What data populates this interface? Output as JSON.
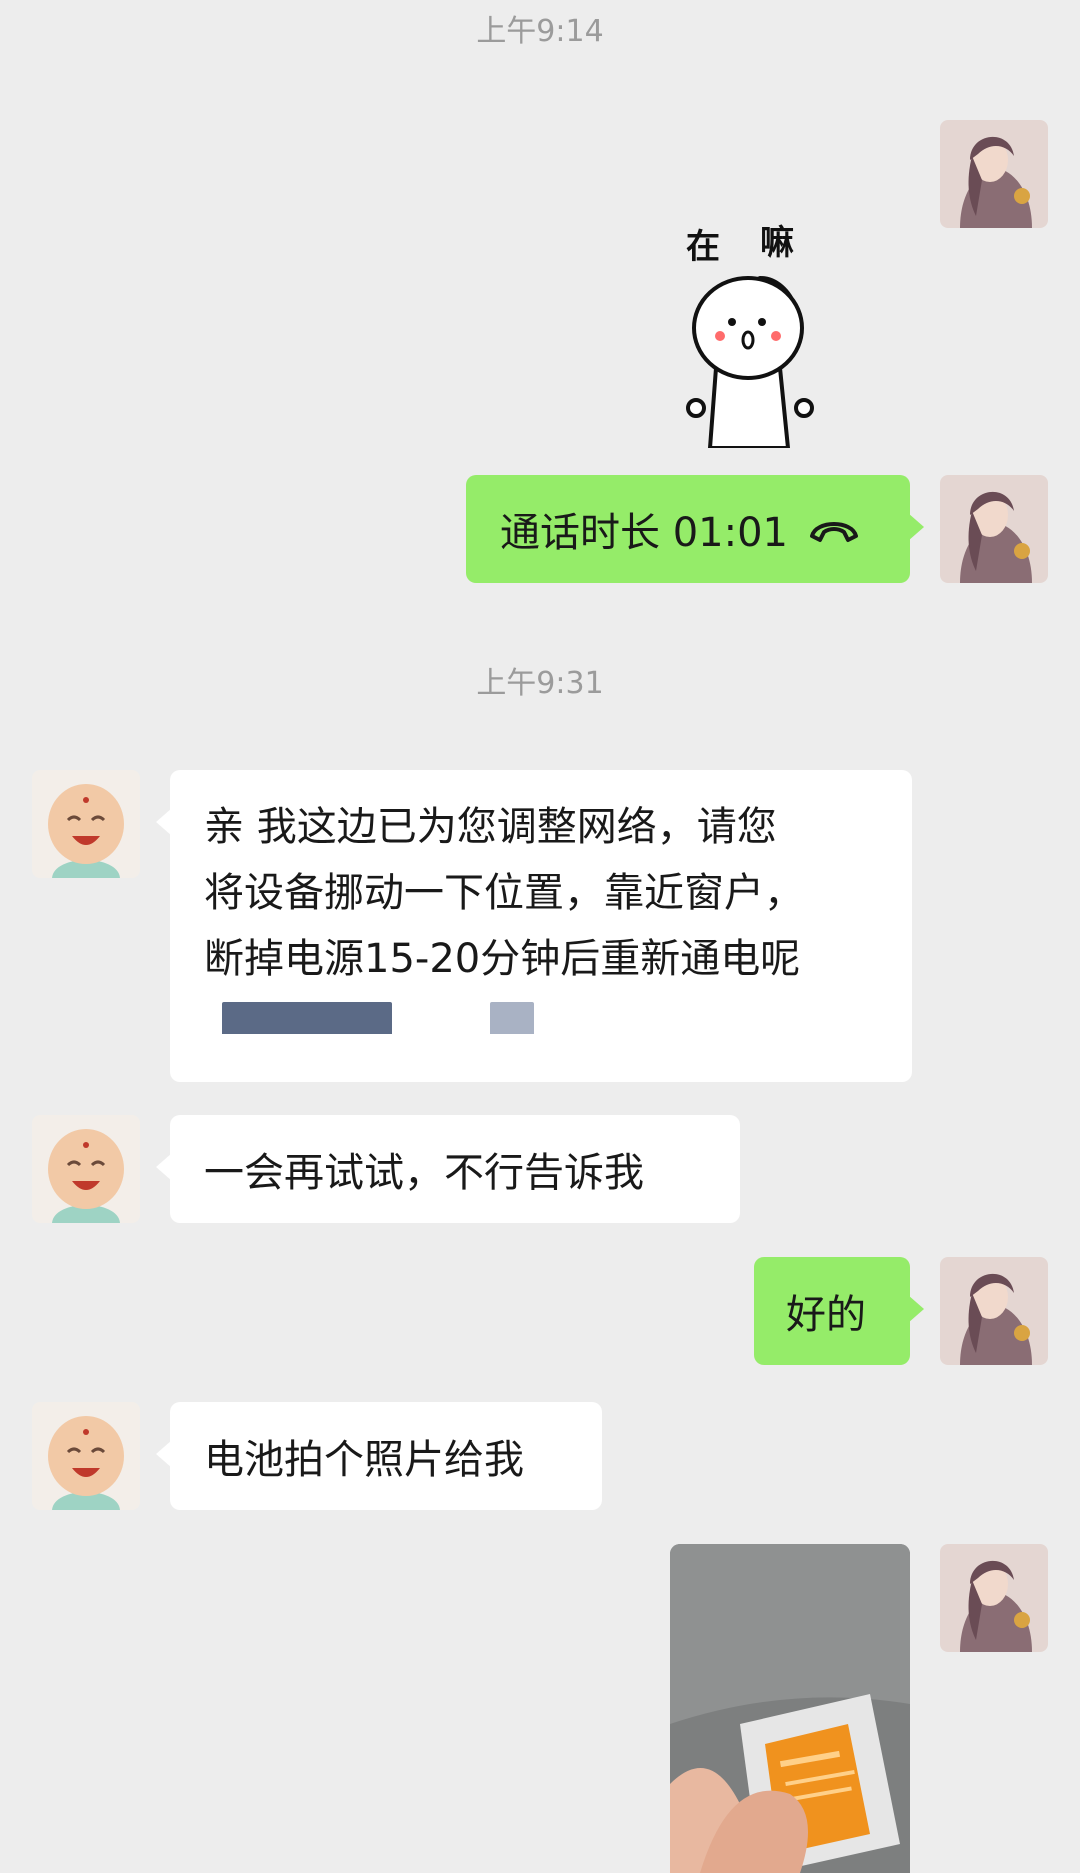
{
  "chat": {
    "timestamps": [
      "上午9:14",
      "上午9:31"
    ],
    "sticker": {
      "text_left": "在",
      "text_right": "嘛"
    },
    "call_message": {
      "label": "通话时长 01:01",
      "icon": "phone-hangup-icon"
    },
    "agent_message_1": {
      "lines": [
        "亲 我这边已为您调整网络，请您",
        "将设备挪动一下位置，靠近窗户，",
        "断掉电源15-20分钟后重新通电呢"
      ]
    },
    "agent_message_2": {
      "text": "一会再试试，不行告诉我"
    },
    "user_message_ok": {
      "text": "好的"
    },
    "agent_message_3": {
      "text": "电池拍个照片给我"
    },
    "colors": {
      "background": "#ededed",
      "sent_bubble": "#95ec69",
      "received_bubble": "#ffffff",
      "timestamp": "#9b9b9b",
      "battery": "#f0921e"
    }
  }
}
